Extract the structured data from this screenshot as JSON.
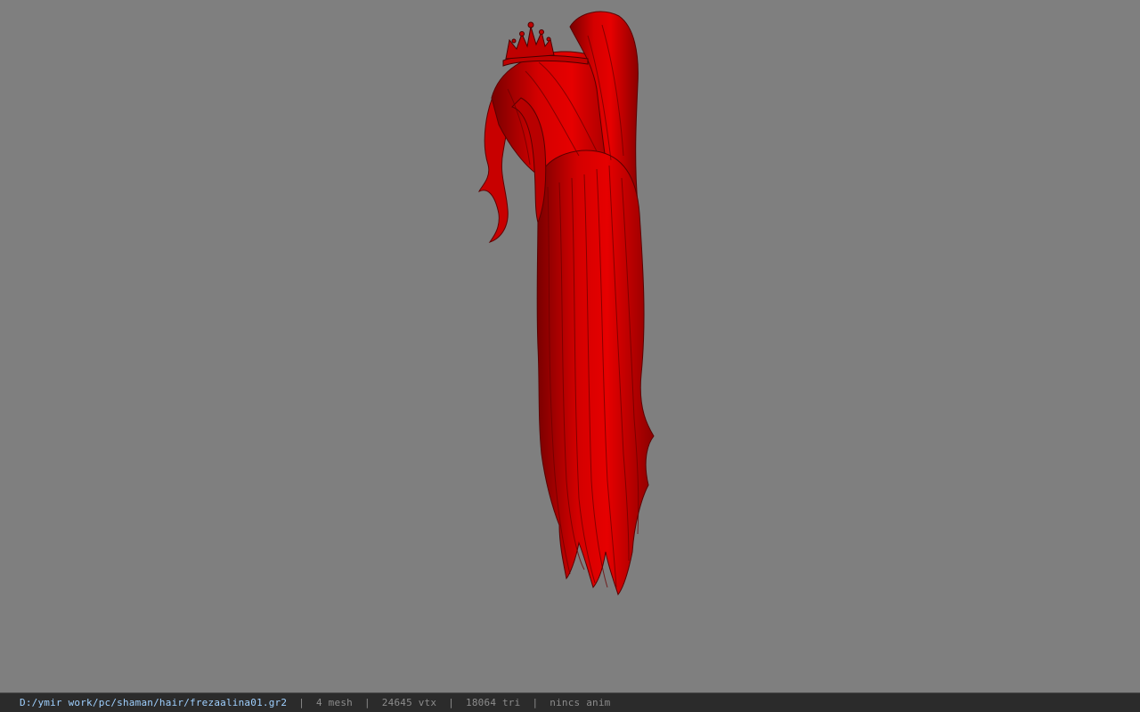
{
  "viewer": {
    "background_color": "#7f7f7f",
    "model": {
      "icon": "hair-ponytail-with-tiara-model",
      "color": "#d90000"
    }
  },
  "statusbar": {
    "file_path": "D:/ymir work/pc/shaman/hair/frezaalina01.gr2",
    "separator": "|",
    "mesh": "4 mesh",
    "vertices": "24645 vtx",
    "triangles": "18064 tri",
    "anim": "nincs anim"
  }
}
